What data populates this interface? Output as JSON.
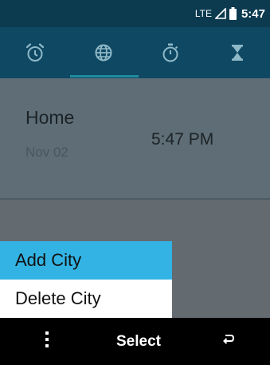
{
  "status_bar": {
    "network_label": "LTE",
    "signal_icon": "signal-icon",
    "battery_icon": "battery-icon",
    "time": "5:47"
  },
  "tabs": [
    {
      "icon": "alarm-clock-icon",
      "selected": false
    },
    {
      "icon": "globe-icon",
      "selected": true
    },
    {
      "icon": "stopwatch-icon",
      "selected": false
    },
    {
      "icon": "hourglass-icon",
      "selected": false
    }
  ],
  "world_clock": {
    "city": "Home",
    "date": "Nov 02",
    "time": "5:47 PM"
  },
  "options_menu": {
    "items": [
      {
        "label": "Add City",
        "selected": true
      },
      {
        "label": "Delete City",
        "selected": false
      }
    ]
  },
  "softkeys": {
    "left_icon": "more-options-icon",
    "center_label": "Select",
    "right_icon": "back-icon"
  },
  "colors": {
    "status_bar_bg": "#0c3a4f",
    "tab_bar_bg": "#0f4863",
    "tab_icon": "#8fb9c7",
    "tab_indicator": "#1f8c9c",
    "menu_highlight": "#32b3e4",
    "softkey_bg": "#000000"
  }
}
